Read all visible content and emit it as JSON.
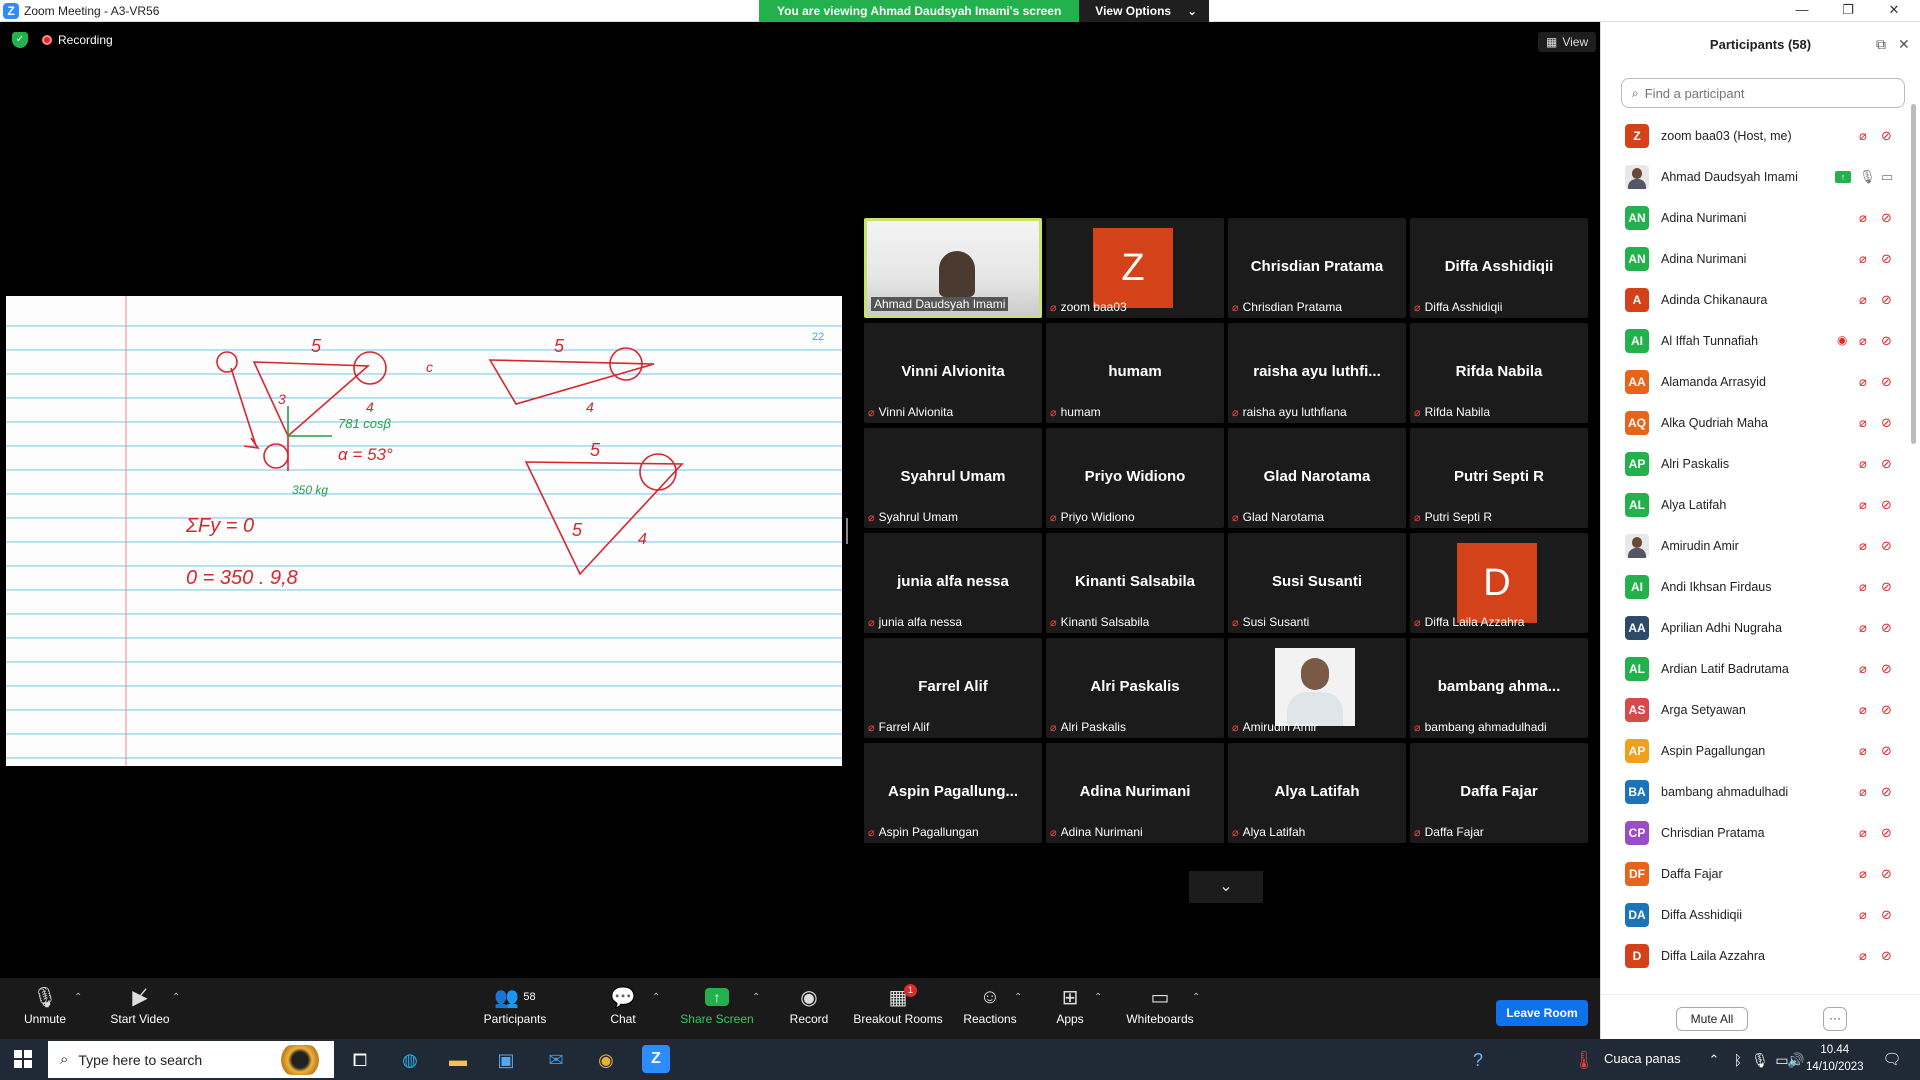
{
  "window": {
    "title": "Zoom Meeting - A3-VR56",
    "minimize": "—",
    "maximize": "❐",
    "close": "✕"
  },
  "banner": {
    "viewing_text": "You are viewing Ahmad Daudsyah Imami's screen",
    "view_options": "View Options"
  },
  "status": {
    "recording": "Recording",
    "view_label": "View"
  },
  "whiteboard": {
    "page_number": "22",
    "notes": [
      "5",
      "c",
      "3",
      "4",
      "781 cosβ",
      "α = 53°",
      "350 kg",
      "ΣFy = 0",
      "0 = 350 . 9,8",
      "5",
      "4",
      "5",
      "5",
      "4"
    ]
  },
  "tiles": [
    {
      "name": "Ahmad Daudsyah Imami",
      "kind": "video"
    },
    {
      "name": "zoom baa03",
      "kind": "avatar",
      "letter": "Z",
      "color": "#d34219"
    },
    {
      "name": "Chrisdian Pratama",
      "big": "Chrisdian Pratama"
    },
    {
      "name": "Diffa Asshidiqii",
      "big": "Diffa Asshidiqii"
    },
    {
      "name": "Vinni Alvionita",
      "big": "Vinni Alvionita"
    },
    {
      "name": "humam",
      "big": "humam"
    },
    {
      "name": "raisha ayu luthfiana",
      "big": "raisha ayu luthfi..."
    },
    {
      "name": "Rifda Nabila",
      "big": "Rifda Nabila"
    },
    {
      "name": "Syahrul Umam",
      "big": "Syahrul Umam"
    },
    {
      "name": "Priyo Widiono",
      "big": "Priyo Widiono"
    },
    {
      "name": "Glad Narotama",
      "big": "Glad Narotama"
    },
    {
      "name": "Putri Septi R",
      "big": "Putri Septi R"
    },
    {
      "name": "junia alfa nessa",
      "big": "junia alfa nessa"
    },
    {
      "name": "Kinanti Salsabila",
      "big": "Kinanti Salsabila"
    },
    {
      "name": "Susi Susanti",
      "big": "Susi Susanti"
    },
    {
      "name": "Diffa Laila Azzahra",
      "kind": "avatar",
      "letter": "D",
      "color": "#d34219"
    },
    {
      "name": "Farrel Alif",
      "big": "Farrel Alif"
    },
    {
      "name": "Alri Paskalis",
      "big": "Alri Paskalis"
    },
    {
      "name": "Amirudin Amir",
      "kind": "photo"
    },
    {
      "name": "bambang ahmadulhadi",
      "big": "bambang ahma..."
    },
    {
      "name": "Aspin Pagallungan",
      "big": "Aspin Pagallung..."
    },
    {
      "name": "Adina Nurimani",
      "big": "Adina Nurimani"
    },
    {
      "name": "Alya Latifah",
      "big": "Alya Latifah"
    },
    {
      "name": "Daffa Fajar",
      "big": "Daffa Fajar"
    }
  ],
  "toolbar": {
    "unmute": "Unmute",
    "start_video": "Start Video",
    "participants": "Participants",
    "participants_count": "58",
    "chat": "Chat",
    "share_screen": "Share Screen",
    "record": "Record",
    "breakout_rooms": "Breakout Rooms",
    "breakout_badge": "1",
    "reactions": "Reactions",
    "apps": "Apps",
    "whiteboards": "Whiteboards",
    "leave_room": "Leave Room"
  },
  "panel": {
    "title": "Participants (58)",
    "search_placeholder": "Find a participant",
    "mute_all": "Mute All",
    "more": "···",
    "participants": [
      {
        "initials": "Z",
        "name": "zoom baa03 (Host, me)",
        "color": "#d34219"
      },
      {
        "initials": "",
        "name": "Ahmad Daudsyah Imami",
        "color": "photo"
      },
      {
        "initials": "AN",
        "name": "Adina Nurimani",
        "color": "#23b14d"
      },
      {
        "initials": "AN",
        "name": "Adina Nurimani",
        "color": "#23b14d"
      },
      {
        "initials": "A",
        "name": "Adinda Chikanaura",
        "color": "#d34219"
      },
      {
        "initials": "AI",
        "name": "Al Iffah Tunnafiah",
        "color": "#23b14d"
      },
      {
        "initials": "AA",
        "name": "Alamanda Arrasyid",
        "color": "#e8641b"
      },
      {
        "initials": "AQ",
        "name": "Alka Qudriah Maha",
        "color": "#e8641b"
      },
      {
        "initials": "AP",
        "name": "Alri Paskalis",
        "color": "#23b14d"
      },
      {
        "initials": "AL",
        "name": "Alya Latifah",
        "color": "#23b14d"
      },
      {
        "initials": "",
        "name": "Amirudin Amir",
        "color": "photo"
      },
      {
        "initials": "AI",
        "name": "Andi Ikhsan Firdaus",
        "color": "#23b14d"
      },
      {
        "initials": "AA",
        "name": "Aprilian Adhi Nugraha",
        "color": "#2d4a6a"
      },
      {
        "initials": "AL",
        "name": "Ardian Latif Badrutama",
        "color": "#23b14d"
      },
      {
        "initials": "AS",
        "name": "Arga Setyawan",
        "color": "#d84a4a"
      },
      {
        "initials": "AP",
        "name": "Aspin Pagallungan",
        "color": "#f0a01a"
      },
      {
        "initials": "BA",
        "name": "bambang ahmadulhadi",
        "color": "#1b74b8"
      },
      {
        "initials": "CP",
        "name": "Chrisdian Pratama",
        "color": "#9b4cc9"
      },
      {
        "initials": "DF",
        "name": "Daffa Fajar",
        "color": "#e8641b"
      },
      {
        "initials": "DA",
        "name": "Diffa Asshidiqii",
        "color": "#1b74b8"
      },
      {
        "initials": "D",
        "name": "Diffa Laila Azzahra",
        "color": "#d34219"
      }
    ]
  },
  "taskbar": {
    "search_placeholder": "Type here to search",
    "weather": "Cuaca panas",
    "time": "10.44",
    "date": "14/10/2023"
  }
}
